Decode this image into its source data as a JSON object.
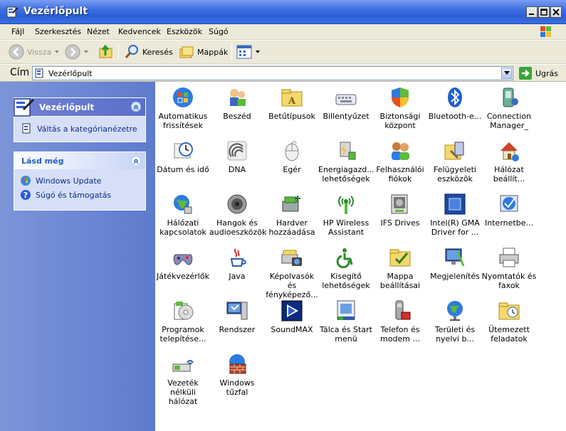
{
  "window": {
    "title": "Vezérlőpult"
  },
  "menu": {
    "items": [
      "Fájl",
      "Szerkesztés",
      "Nézet",
      "Kedvencek",
      "Eszközök",
      "Súgó"
    ]
  },
  "toolbar": {
    "back_label": "Vissza",
    "search_label": "Keresés",
    "folders_label": "Mappák"
  },
  "address": {
    "label": "Cím",
    "value": "Vezérlőpult",
    "go_label": "Ugrás"
  },
  "sidebar": {
    "cp_panel": {
      "title": "Vezérlőpult",
      "link": "Váltás a kategórianézetre"
    },
    "see_also": {
      "title": "Lásd még",
      "links": [
        "Windows Update",
        "Súgó és támogatás"
      ]
    }
  },
  "icons": [
    {
      "label": "Automatikus\nfrissítések",
      "icon": "windows-update-icon"
    },
    {
      "label": "Beszéd",
      "icon": "speech-icon"
    },
    {
      "label": "Betűtípusok",
      "icon": "fonts-folder-icon"
    },
    {
      "label": "Billentyűzet",
      "icon": "keyboard-icon"
    },
    {
      "label": "Biztonsági\nközpont",
      "icon": "security-shield-icon"
    },
    {
      "label": "Bluetooth-e...",
      "icon": "bluetooth-icon"
    },
    {
      "label": "Connection\nManager_",
      "icon": "connection-manager-icon"
    },
    {
      "label": "Dátum és idő",
      "icon": "clock-icon"
    },
    {
      "label": "DNA",
      "icon": "dna-icon"
    },
    {
      "label": "Egér",
      "icon": "mouse-icon"
    },
    {
      "label": "Energiagazd...\nlehetőségek",
      "icon": "power-options-icon"
    },
    {
      "label": "Felhasználói\nfiókok",
      "icon": "user-accounts-icon"
    },
    {
      "label": "Felügyeleti\neszközök",
      "icon": "admin-tools-icon"
    },
    {
      "label": "Hálózat\nbeállít...",
      "icon": "network-setup-icon"
    },
    {
      "label": "Hálózati\nkapcsolatok",
      "icon": "network-connections-icon"
    },
    {
      "label": "Hangok és\naudioeszközök",
      "icon": "speaker-icon"
    },
    {
      "label": "Hardver\nhozzáadása",
      "icon": "add-hardware-icon"
    },
    {
      "label": "HP Wireless\nAssistant",
      "icon": "wireless-antenna-icon"
    },
    {
      "label": "IFS Drives",
      "icon": "ifs-drives-icon"
    },
    {
      "label": "Intel(R) GMA\nDriver for ...",
      "icon": "intel-gma-icon"
    },
    {
      "label": "Internetbe...",
      "icon": "internet-options-icon"
    },
    {
      "label": "Játékvezérlők",
      "icon": "gamepad-icon"
    },
    {
      "label": "Java",
      "icon": "java-cup-icon"
    },
    {
      "label": "Képolvasók és\nfényképező...",
      "icon": "scanner-camera-icon"
    },
    {
      "label": "Kisegítő\nlehetőségek",
      "icon": "accessibility-icon"
    },
    {
      "label": "Mappa\nbeállításai",
      "icon": "folder-options-icon"
    },
    {
      "label": "Megjelenítés",
      "icon": "display-icon"
    },
    {
      "label": "Nyomtatók és\nfaxok",
      "icon": "printer-icon"
    },
    {
      "label": "Programok\ntelepítése...",
      "icon": "add-remove-programs-icon"
    },
    {
      "label": "Rendszer",
      "icon": "system-icon"
    },
    {
      "label": "SoundMAX",
      "icon": "soundmax-icon"
    },
    {
      "label": "Tálca és Start\nmenü",
      "icon": "taskbar-icon"
    },
    {
      "label": "Telefon és\nmodem ...",
      "icon": "phone-modem-icon"
    },
    {
      "label": "Területi és\nnyelvi b...",
      "icon": "regional-globe-icon"
    },
    {
      "label": "Ütemezett\nfeladatok",
      "icon": "scheduled-tasks-icon"
    },
    {
      "label": "Vezeték nélküli\nhálózat",
      "icon": "wireless-network-icon"
    },
    {
      "label": "Windows tűzfal",
      "icon": "firewall-icon"
    }
  ]
}
